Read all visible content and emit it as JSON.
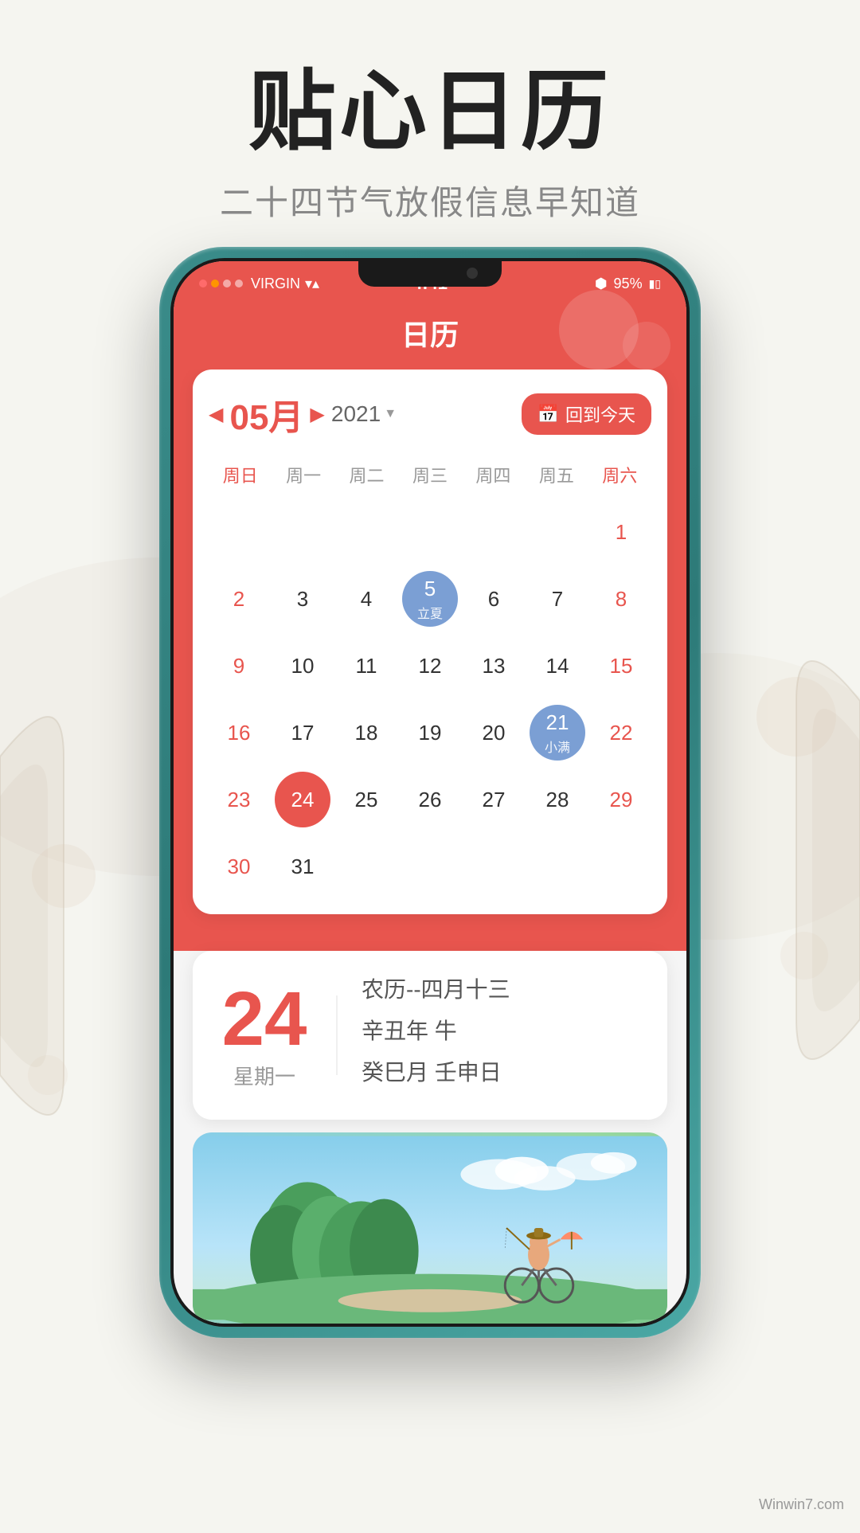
{
  "page": {
    "bg_color": "#f2f0eb"
  },
  "header": {
    "main_title": "贴心日历",
    "subtitle": "二十四节气放假信息早知道"
  },
  "phone": {
    "status_bar": {
      "carrier": "VIRGIN",
      "time": "4:41",
      "battery": "95%",
      "signal": "●●○○"
    },
    "app_title": "日历",
    "today_btn": "回到今天",
    "month_label": "05月",
    "year_label": "2021",
    "week_days": [
      "周日",
      "周一",
      "周二",
      "周三",
      "周四",
      "周五",
      "周六"
    ],
    "calendar": {
      "rows": [
        [
          {
            "n": "",
            "s": ""
          },
          {
            "n": "",
            "s": ""
          },
          {
            "n": "",
            "s": ""
          },
          {
            "n": "",
            "s": ""
          },
          {
            "n": "",
            "s": ""
          },
          {
            "n": "",
            "s": ""
          },
          {
            "n": "1",
            "s": "",
            "type": "sat"
          }
        ],
        [
          {
            "n": "2",
            "s": "",
            "type": "sun"
          },
          {
            "n": "3",
            "s": ""
          },
          {
            "n": "4",
            "s": ""
          },
          {
            "n": "5",
            "s": "立夏",
            "type": "solar"
          },
          {
            "n": "6",
            "s": ""
          },
          {
            "n": "7",
            "s": ""
          },
          {
            "n": "8",
            "s": "",
            "type": "sat"
          }
        ],
        [
          {
            "n": "9",
            "s": "",
            "type": "sun"
          },
          {
            "n": "10",
            "s": ""
          },
          {
            "n": "11",
            "s": ""
          },
          {
            "n": "12",
            "s": ""
          },
          {
            "n": "13",
            "s": ""
          },
          {
            "n": "14",
            "s": ""
          },
          {
            "n": "15",
            "s": "",
            "type": "sat"
          }
        ],
        [
          {
            "n": "16",
            "s": "",
            "type": "sun"
          },
          {
            "n": "17",
            "s": ""
          },
          {
            "n": "18",
            "s": ""
          },
          {
            "n": "19",
            "s": ""
          },
          {
            "n": "20",
            "s": ""
          },
          {
            "n": "21",
            "s": "小满",
            "type": "solar"
          },
          {
            "n": "22",
            "s": "",
            "type": "sat"
          }
        ],
        [
          {
            "n": "23",
            "s": "",
            "type": "sun"
          },
          {
            "n": "24",
            "s": "",
            "type": "today"
          },
          {
            "n": "25",
            "s": ""
          },
          {
            "n": "26",
            "s": ""
          },
          {
            "n": "27",
            "s": ""
          },
          {
            "n": "28",
            "s": ""
          },
          {
            "n": "29",
            "s": "",
            "type": "sat"
          }
        ],
        [
          {
            "n": "30",
            "s": "",
            "type": "sun"
          },
          {
            "n": "31",
            "s": ""
          },
          {
            "n": "",
            "s": ""
          },
          {
            "n": "",
            "s": ""
          },
          {
            "n": "",
            "s": ""
          },
          {
            "n": "",
            "s": ""
          },
          {
            "n": "",
            "s": ""
          }
        ]
      ]
    },
    "date_detail": {
      "day": "24",
      "weekday": "星期一",
      "lunar": "农历--四月十三",
      "year_zodiac": "辛丑年 牛",
      "ganzhi": "癸巳月 壬申日"
    },
    "solar_term": {
      "name": "立夏",
      "subtitle": "二十四节气"
    }
  },
  "bottom_logo": "Winwin7.com",
  "colors": {
    "red": "#e8554e",
    "blue_circle": "#7b9fd4",
    "today_circle": "#e8554e",
    "sat_color": "#e8554e",
    "sun_color": "#e8554e"
  }
}
